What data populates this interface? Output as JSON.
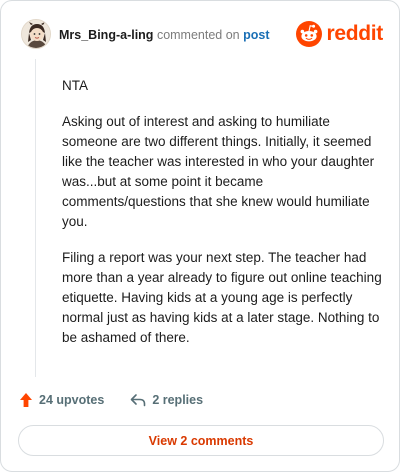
{
  "header": {
    "username": "Mrs_Bing-a-ling",
    "commented_text": "commented on",
    "post_link": "post",
    "brand": "reddit"
  },
  "comment": {
    "paragraphs": [
      "NTA",
      "Asking out of interest and asking to humiliate someone are two different things. Initially, it seemed like the teacher was interested in who your daughter was...but at some point it became comments/questions that she knew would humiliate you.",
      "Filing a report was your next step. The teacher had more than a year already to figure out online teaching etiquette. Having kids at a young age is perfectly normal just as having kids at a later stage. Nothing to be ashamed of there."
    ]
  },
  "actions": {
    "upvotes": "24 upvotes",
    "replies": "2 replies"
  },
  "view_comments_label": "View 2 comments",
  "colors": {
    "brand": "#ff4500",
    "link": "#1a6fb5",
    "upvote": "#ff4500",
    "muted": "#576f76",
    "view_button_text": "#d93900"
  },
  "icons": {
    "avatar": "user-avatar",
    "brand_logo": "reddit-snoo-icon",
    "upvote": "upvote-arrow-icon",
    "reply": "reply-arrow-icon"
  }
}
